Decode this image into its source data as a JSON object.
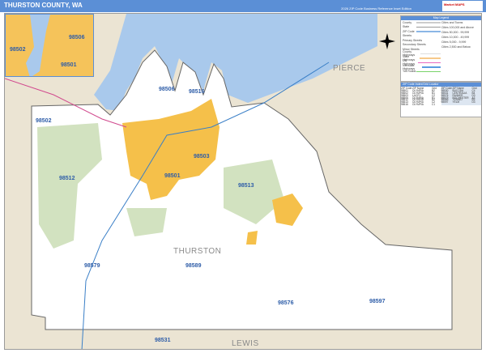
{
  "header": {
    "title": "THURSTON COUNTY, WA",
    "subtitle": "2026 ZIP Code Business Reference Inset Edition",
    "logo": "Market MAPS"
  },
  "colors": {
    "header": "#5b8fd6",
    "urban": "#f5c04a",
    "water": "#a9c9ec",
    "forest": "#d2e2c0",
    "background": "#ebe4d3",
    "zip_label": "#2e5da8"
  },
  "map": {
    "county_labels": [
      "THURSTON",
      "PIERCE",
      "LEWIS"
    ],
    "zip_labels": [
      "98502",
      "98512",
      "98501",
      "98506",
      "98516",
      "98503",
      "98513",
      "98579",
      "98589",
      "98576",
      "98597",
      "98531"
    ],
    "inset_labels": [
      "98506",
      "98502",
      "98501"
    ],
    "compass_icon": "compass-rose-icon"
  },
  "legend": {
    "title": "Map Legend",
    "items": [
      "County",
      "State",
      "ZIP Code",
      "Streets",
      "Primary Streets",
      "Secondary Streets",
      "Minor Streets",
      "County Highways",
      "State Highways",
      "US Highways",
      "Interstate Highways",
      "Toll Roads"
    ],
    "cities_title": "Cities and Towns",
    "cities": [
      "Cities 100,000 and Above",
      "Cities 50,000 - 99,999",
      "Cities 10,000 - 49,999",
      "Cities 5,000 - 9,999",
      "Cities 2,500 and Below"
    ]
  },
  "zip_table": {
    "title": "ZIP Code Index/Grid Locator",
    "headers": [
      "ZIP Code",
      "ZIP Name",
      "Grid"
    ],
    "left": [
      [
        "98501",
        "OLYMPIA",
        "B2"
      ],
      [
        "98502",
        "OLYMPIA",
        "B1"
      ],
      [
        "98503",
        "LACEY",
        "C2"
      ],
      [
        "98506",
        "OLYMPIA",
        "B1"
      ],
      [
        "98512",
        "OLYMPIA",
        "A2"
      ],
      [
        "98513",
        "OLYMPIA",
        "C2"
      ],
      [
        "98516",
        "OLYMPIA",
        "C1"
      ]
    ],
    "right": [
      [
        "98530",
        "BUCODA",
        "C4"
      ],
      [
        "98531",
        "CENTRALIA",
        "B4"
      ],
      [
        "98576",
        "RAINIER",
        "D3"
      ],
      [
        "98579",
        "ROCHESTER",
        "A3"
      ],
      [
        "98589",
        "TENINO",
        "B3"
      ],
      [
        "98597",
        "YELM",
        "D3"
      ]
    ]
  }
}
